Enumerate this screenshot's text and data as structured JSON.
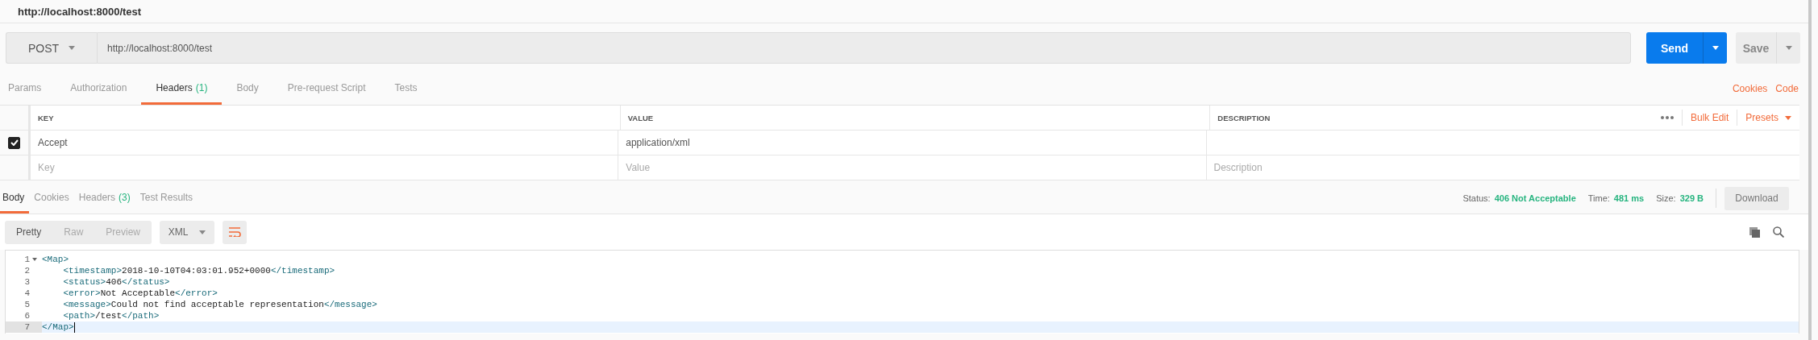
{
  "window": {
    "title": "http://localhost:8000/test"
  },
  "request": {
    "method": "POST",
    "url": "http://localhost:8000/test",
    "send_label": "Send",
    "save_label": "Save"
  },
  "request_tabs": [
    {
      "label": "Params",
      "selected": false
    },
    {
      "label": "Authorization",
      "selected": false
    },
    {
      "label": "Headers",
      "count": "(1)",
      "selected": true
    },
    {
      "label": "Body",
      "selected": false
    },
    {
      "label": "Pre-request Script",
      "selected": false
    },
    {
      "label": "Tests",
      "selected": false
    }
  ],
  "request_links": [
    "Cookies",
    "Code"
  ],
  "headers_table": {
    "columns": [
      "KEY",
      "VALUE",
      "DESCRIPTION"
    ],
    "actions": [
      "Bulk Edit",
      "Presets"
    ],
    "rows": [
      {
        "checked": true,
        "key": "Accept",
        "value": "application/xml"
      }
    ],
    "placeholder_row": {
      "key_placeholder": "Key",
      "value_placeholder": "Value",
      "description_placeholder": "Description"
    }
  },
  "response_tabs": [
    {
      "label": "Body",
      "selected": true
    },
    {
      "label": "Cookies",
      "selected": false
    },
    {
      "label": "Headers",
      "count": "(3)",
      "selected": false
    },
    {
      "label": "Test Results",
      "selected": false
    }
  ],
  "response_meta": [
    {
      "label": "Status:",
      "value": "406 Not Acceptable"
    },
    {
      "label": "Time:",
      "value": "481 ms"
    },
    {
      "label": "Size:",
      "value": "329 B"
    }
  ],
  "download_label": "Download",
  "view_modes": [
    {
      "label": "Pretty",
      "selected": true
    },
    {
      "label": "Raw",
      "selected": false
    },
    {
      "label": "Preview",
      "selected": false
    }
  ],
  "format": "XML",
  "code": {
    "lines": [
      {
        "number": "1",
        "text": "<Map>",
        "foldable": true,
        "highlighted": false
      },
      {
        "number": "2",
        "text": "    <timestamp>2018-10-10T04:03:01.952+0000</timestamp>",
        "foldable": false,
        "highlighted": false
      },
      {
        "number": "3",
        "text": "    <status>406</status>",
        "foldable": false,
        "highlighted": false
      },
      {
        "number": "4",
        "text": "    <error>Not Acceptable</error>",
        "foldable": false,
        "highlighted": false
      },
      {
        "number": "5",
        "text": "    <message>Could not find acceptable representation</message>",
        "foldable": false,
        "highlighted": false
      },
      {
        "number": "6",
        "text": "    <path>/test</path>",
        "foldable": false,
        "highlighted": false
      },
      {
        "number": "7",
        "text": "</Map>",
        "foldable": false,
        "highlighted": true
      }
    ]
  }
}
